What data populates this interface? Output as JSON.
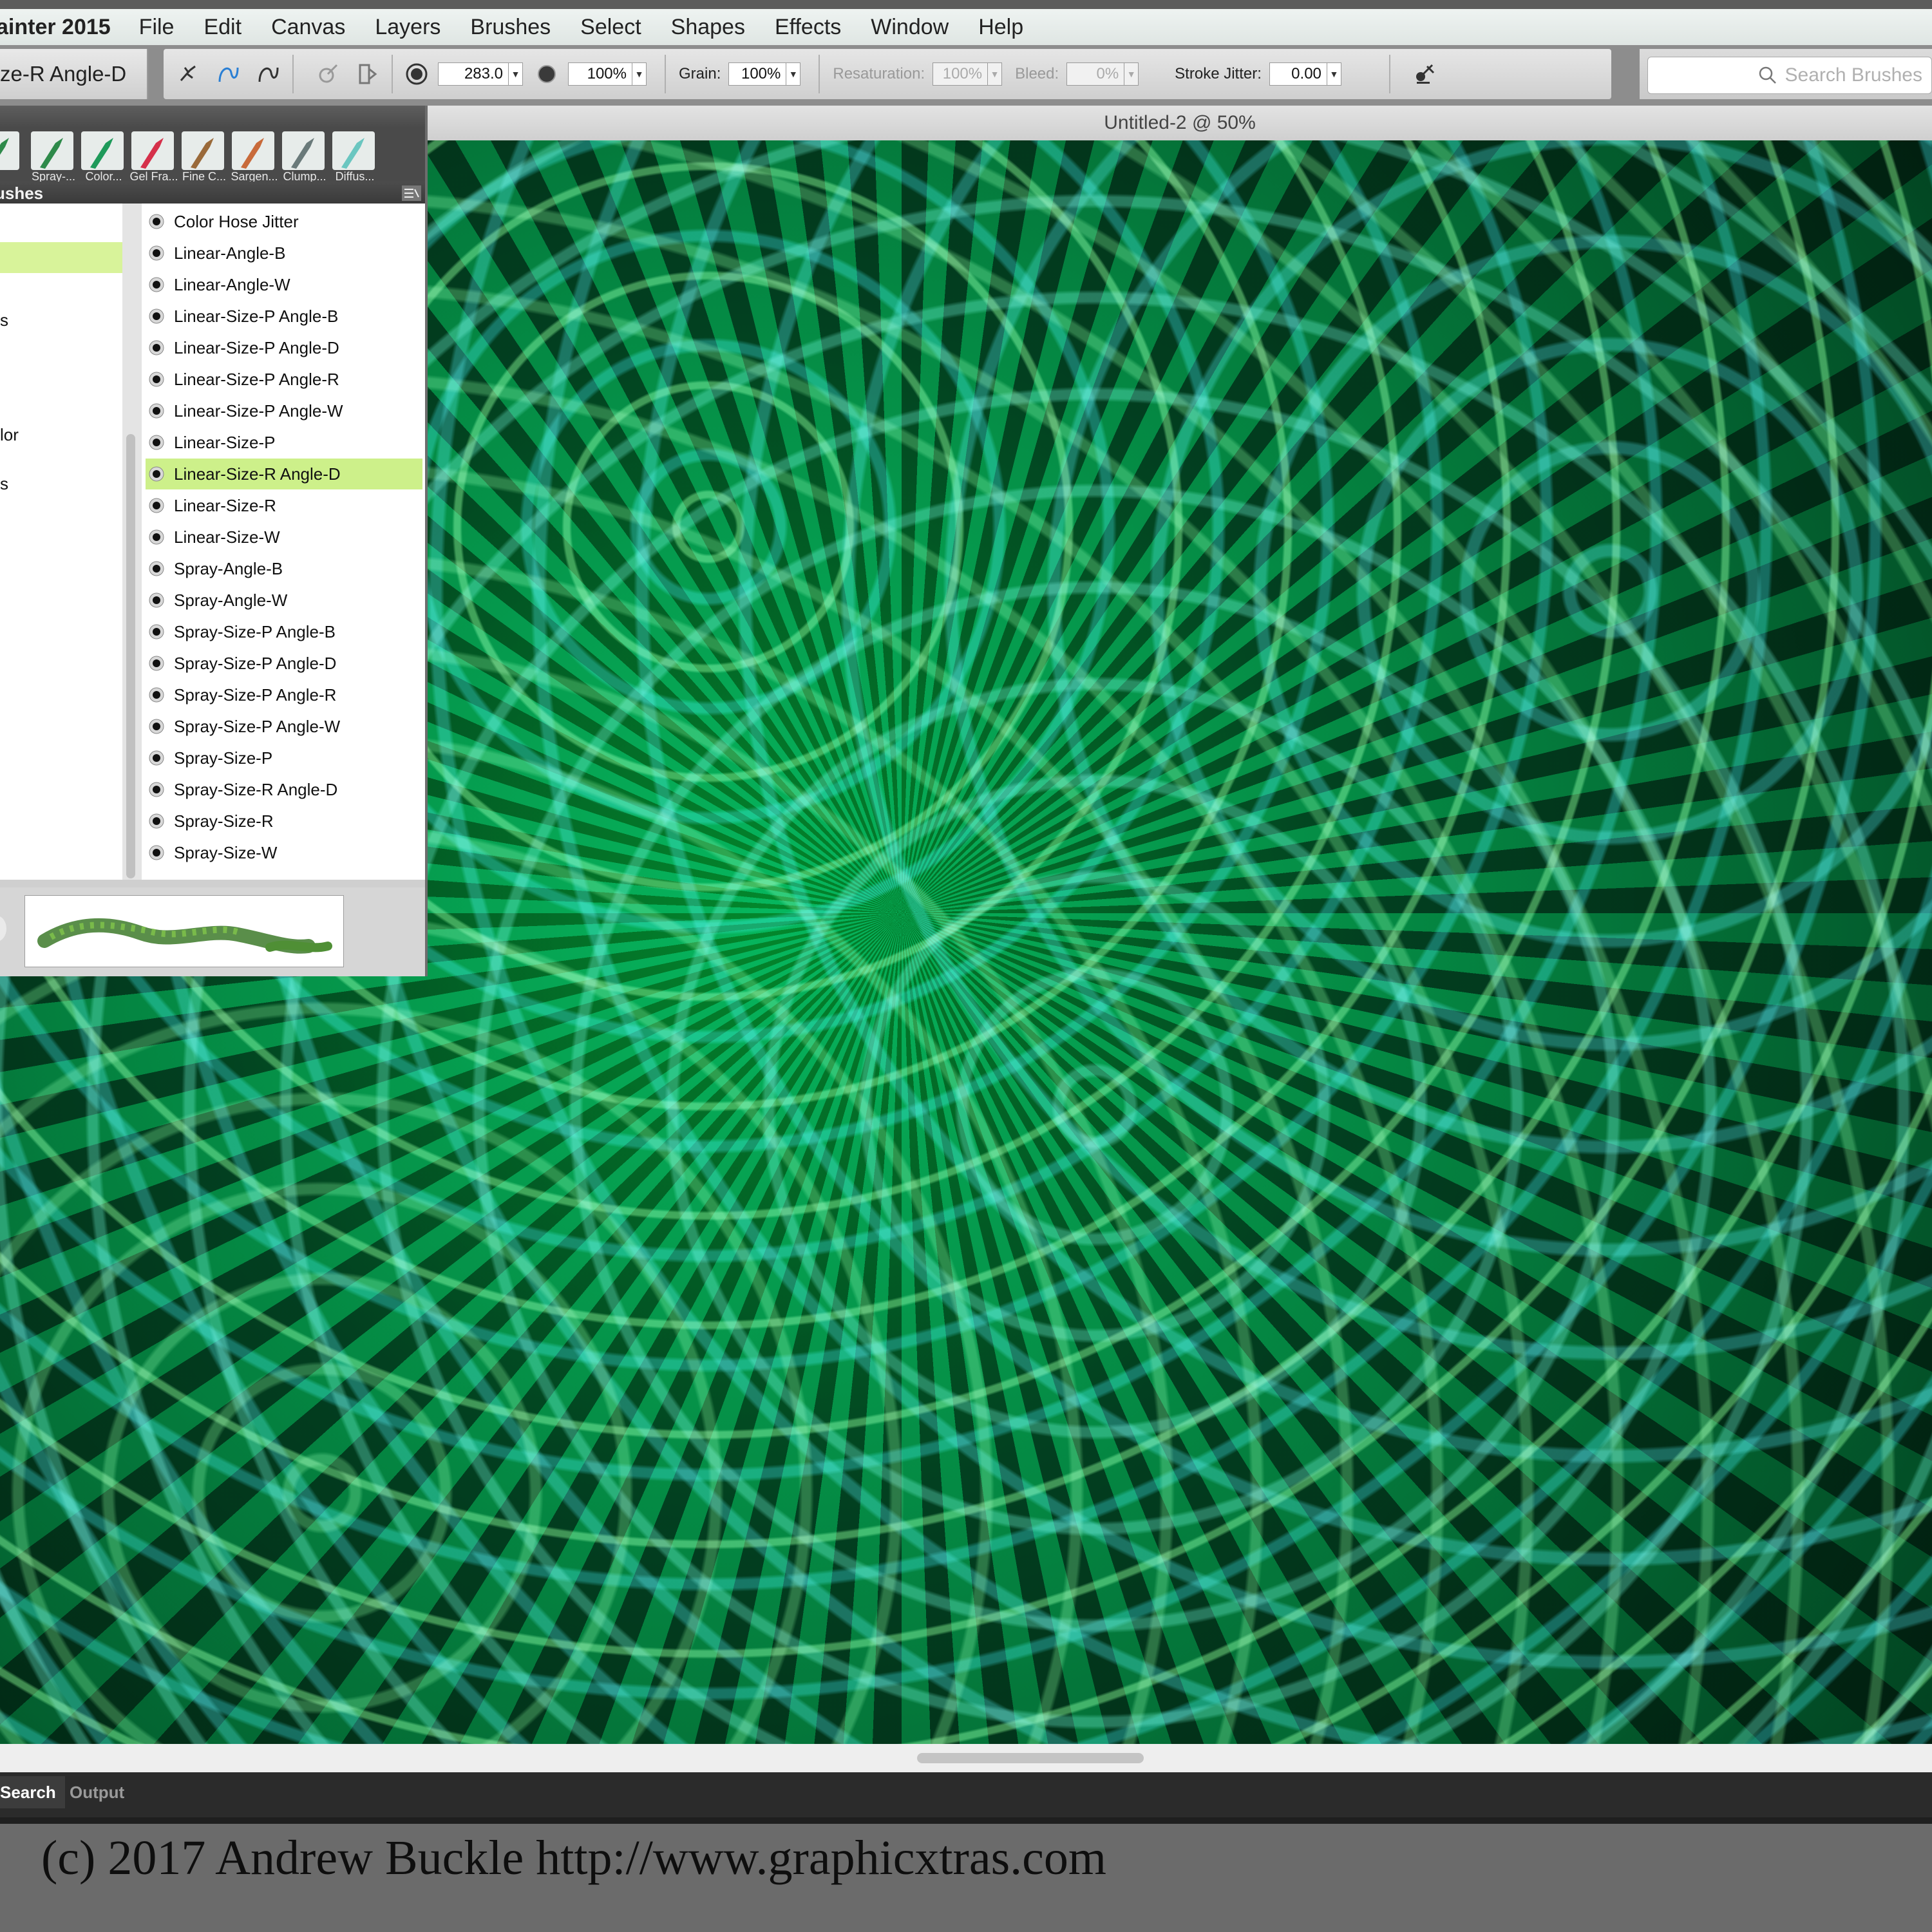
{
  "app": {
    "name": "ainter 2015"
  },
  "menu": [
    "File",
    "Edit",
    "Canvas",
    "Layers",
    "Brushes",
    "Select",
    "Shapes",
    "Effects",
    "Window",
    "Help"
  ],
  "property_bar": {
    "current_brush": "ze-R Angle-D",
    "size": "283.0",
    "opacity": "100%",
    "grain_label": "Grain:",
    "grain": "100%",
    "resaturation_label": "Resaturation:",
    "resaturation": "100%",
    "bleed_label": "Bleed:",
    "bleed": "0%",
    "stroke_jitter_label": "Stroke Jitter:",
    "stroke_jitter": "0.00"
  },
  "search": {
    "placeholder": "Search Brushes"
  },
  "document": {
    "title": "Untitled-2 @ 50%"
  },
  "brush_panel": {
    "header": "ushes",
    "categories": [
      "Spray-...",
      "Color...",
      "Gel Fra...",
      "Fine C...",
      "Sargen...",
      "Clump...",
      "Diffus..."
    ],
    "category_colors": [
      "#2e8a4a",
      "#1e9a5a",
      "#d5304a",
      "#9a6a3a",
      "#c86a3a",
      "#6a7a7a",
      "#6ac6c0"
    ],
    "left_fragments": [
      "s",
      "lor",
      "s"
    ],
    "variants": [
      "Color Hose Jitter",
      "Linear-Angle-B",
      "Linear-Angle-W",
      "Linear-Size-P Angle-B",
      "Linear-Size-P Angle-D",
      "Linear-Size-P Angle-R",
      "Linear-Size-P Angle-W",
      "Linear-Size-P",
      "Linear-Size-R Angle-D",
      "Linear-Size-R",
      "Linear-Size-W",
      "Spray-Angle-B",
      "Spray-Angle-W",
      "Spray-Size-P Angle-B",
      "Spray-Size-P Angle-D",
      "Spray-Size-P Angle-R",
      "Spray-Size-P Angle-W",
      "Spray-Size-P",
      "Spray-Size-R Angle-D",
      "Spray-Size-R",
      "Spray-Size-W"
    ],
    "selected_variant": "Linear-Size-R Angle-D"
  },
  "bottom_tabs": {
    "search": "Search",
    "output": "Output"
  },
  "footer": {
    "copyright": "(c) 2017 Andrew Buckle http://www.graphicxtras.com"
  },
  "colors": {
    "selection": "#cdf08a",
    "accent_icon": "#2a7fd4"
  }
}
